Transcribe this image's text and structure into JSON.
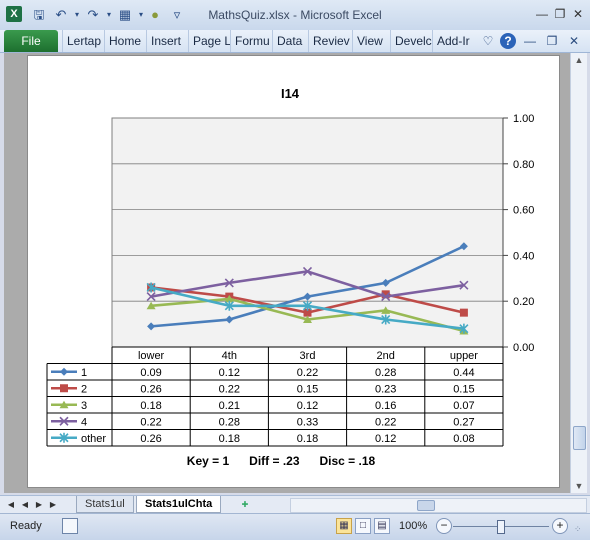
{
  "window": {
    "title": "MathsQuiz.xlsx  -  Microsoft Excel",
    "app_icon": "X"
  },
  "ribbon": {
    "file_label": "File",
    "tabs": [
      "Lertap",
      "Home",
      "Insert",
      "Page L",
      "Formu",
      "Data",
      "Reviev",
      "View",
      "Develc",
      "Add-Ir"
    ]
  },
  "chart_data": {
    "type": "line",
    "title": "I14",
    "categories": [
      "lower",
      "4th",
      "3rd",
      "2nd",
      "upper"
    ],
    "ylim": [
      0,
      1
    ],
    "yticks": [
      "0.00",
      "0.20",
      "0.40",
      "0.60",
      "0.80",
      "1.00"
    ],
    "y_axis_position": "right",
    "grid": true,
    "legend": "data-table",
    "series": [
      {
        "name": "1",
        "color": "#4a7ebb",
        "marker": "diamond",
        "values": [
          0.09,
          0.12,
          0.22,
          0.28,
          0.44
        ],
        "labels": [
          "0.09",
          "0.12",
          "0.22",
          "0.28",
          "0.44"
        ]
      },
      {
        "name": "2",
        "color": "#be4b48",
        "marker": "square",
        "values": [
          0.26,
          0.22,
          0.15,
          0.23,
          0.15
        ],
        "labels": [
          "0.26",
          "0.22",
          "0.15",
          "0.23",
          "0.15"
        ]
      },
      {
        "name": "3",
        "color": "#98b954",
        "marker": "triangle",
        "values": [
          0.18,
          0.21,
          0.12,
          0.16,
          0.07
        ],
        "labels": [
          "0.18",
          "0.21",
          "0.12",
          "0.16",
          "0.07"
        ]
      },
      {
        "name": "4",
        "color": "#7d60a0",
        "marker": "x",
        "values": [
          0.22,
          0.28,
          0.33,
          0.22,
          0.27
        ],
        "labels": [
          "0.22",
          "0.28",
          "0.33",
          "0.22",
          "0.27"
        ]
      },
      {
        "name": "other",
        "color": "#46aac5",
        "marker": "star",
        "values": [
          0.26,
          0.18,
          0.18,
          0.12,
          0.08
        ],
        "labels": [
          "0.26",
          "0.18",
          "0.18",
          "0.12",
          "0.08"
        ]
      }
    ],
    "footnote": "Key = 1      Diff = .23      Disc = .18"
  },
  "sheet_tabs": [
    "Stats1ul",
    "Stats1ulChta"
  ],
  "status": {
    "ready": "Ready",
    "zoom": "100%"
  }
}
